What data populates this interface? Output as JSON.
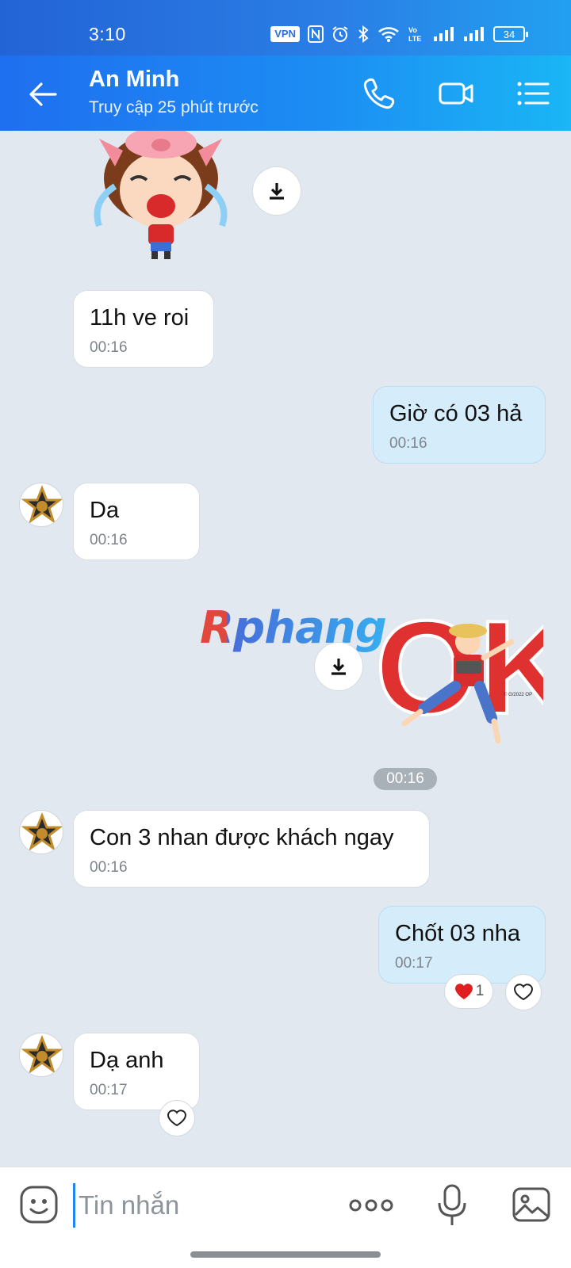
{
  "status_bar": {
    "time": "3:10",
    "vpn": "VPN",
    "volte": "Vo LTE",
    "battery": "34"
  },
  "header": {
    "contact_name": "An Minh",
    "contact_status": "Truy cập 25 phút trước",
    "icons": [
      "back-arrow-icon",
      "phone-icon",
      "video-camera-icon",
      "menu-list-icon"
    ]
  },
  "messages": [
    {
      "type": "sticker",
      "side": "them",
      "sticker": "crying girl with pig hat"
    },
    {
      "type": "text",
      "side": "them",
      "text": "11h ve roi",
      "time": "00:16"
    },
    {
      "type": "text",
      "side": "me",
      "text": "Giờ có 03 hả",
      "time": "00:16"
    },
    {
      "type": "text",
      "side": "them",
      "text": "Da",
      "time": "00:16"
    },
    {
      "type": "sticker",
      "side": "me",
      "sticker": "OK with character"
    },
    {
      "type": "text",
      "side": "them",
      "text": "Con 3 nhan được khách ngay",
      "time": "00:16"
    },
    {
      "type": "text",
      "side": "me",
      "text": "Chốt 03 nha",
      "time": "00:17",
      "reaction_count": "1"
    },
    {
      "type": "text",
      "side": "them",
      "text": "Dạ anh",
      "time": "00:17"
    }
  ],
  "sticker_ok": {
    "label": "OK",
    "copyright": "© G/2022 OP"
  },
  "time_divider": "00:16",
  "watermark": "Rphang",
  "input": {
    "placeholder": "Tin nhắn"
  },
  "colors": {
    "header_start": "#1f6ff0",
    "header_end": "#1ab6f5",
    "chat_bg": "#e2e8ef",
    "my_bubble": "#d5ecfb",
    "their_bubble": "#ffffff"
  }
}
